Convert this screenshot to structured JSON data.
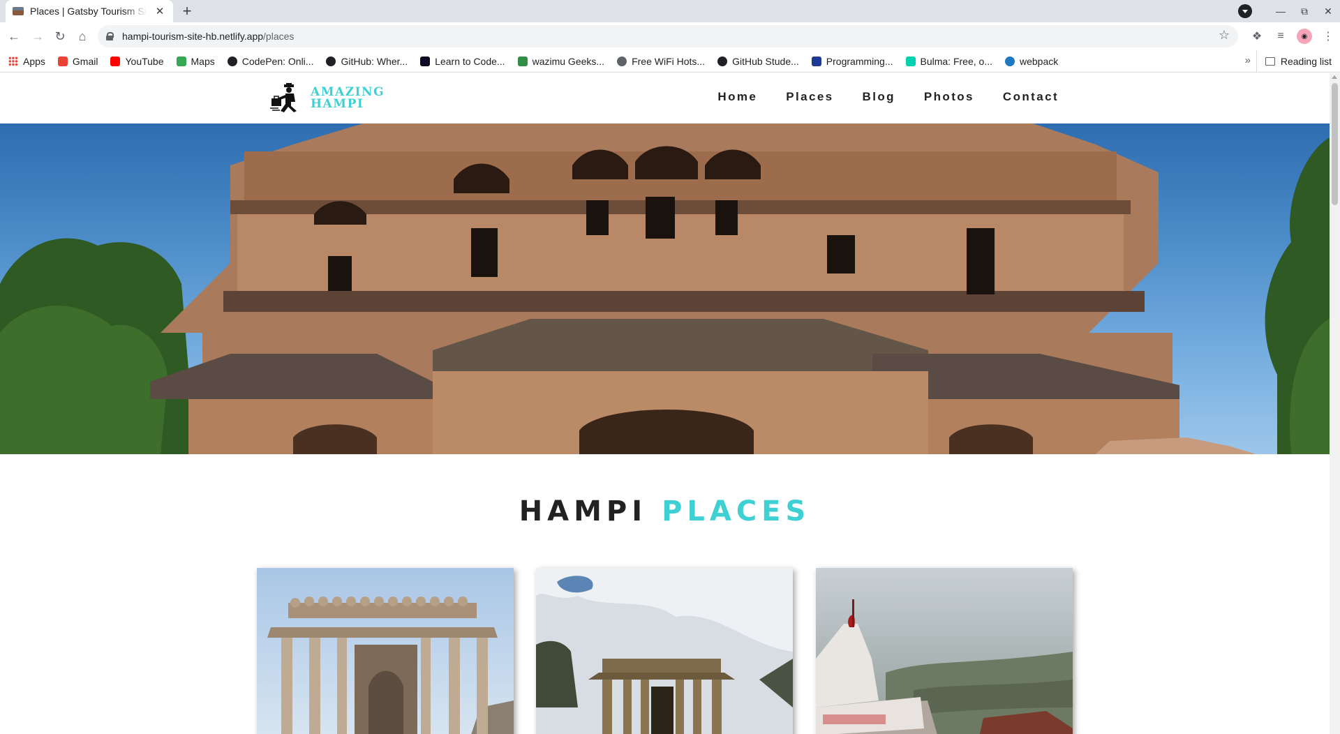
{
  "browser": {
    "tab_title": "Places | Gatsby Tourism Si",
    "tab_close": "✕",
    "new_tab": "+",
    "url_host": "hampi-tourism-site-hb.netlify.app",
    "url_path": "/places",
    "bookmarks": [
      {
        "label": "Apps",
        "icon": "apps-grid-icon",
        "color": "#ea4335"
      },
      {
        "label": "Gmail",
        "icon": "gmail-icon",
        "color": "#ea4335"
      },
      {
        "label": "YouTube",
        "icon": "youtube-icon",
        "color": "#ff0000"
      },
      {
        "label": "Maps",
        "icon": "maps-pin-icon",
        "color": "#34a853"
      },
      {
        "label": "CodePen: Onli...",
        "icon": "codepen-icon",
        "color": "#202124"
      },
      {
        "label": "GitHub: Wher...",
        "icon": "github-icon",
        "color": "#202124"
      },
      {
        "label": "Learn to Code...",
        "icon": "freecodecamp-icon",
        "color": "#0a0a23"
      },
      {
        "label": "wazimu Geeks...",
        "icon": "wazimu-icon",
        "color": "#2f8d46"
      },
      {
        "label": "Free WiFi Hots...",
        "icon": "globe-icon",
        "color": "#5f6368"
      },
      {
        "label": "GitHub Stude...",
        "icon": "github-icon",
        "color": "#202124"
      },
      {
        "label": "Programming...",
        "icon": "programming-icon",
        "color": "#1f3a93"
      },
      {
        "label": "Bulma: Free, o...",
        "icon": "bulma-icon",
        "color": "#00d1b2"
      },
      {
        "label": "webpack",
        "icon": "webpack-icon",
        "color": "#1c78c0"
      }
    ],
    "bookmarks_overflow": "»",
    "reading_list": "Reading list"
  },
  "site": {
    "logo_line1": "AMAZING",
    "logo_line2": "HAMPI",
    "menu": [
      "Home",
      "Places",
      "Blog",
      "Photos",
      "Contact"
    ],
    "section_title_dark": "HAMPI",
    "section_title_accent": "PLACES",
    "cards": [
      {
        "name": "pillared-mandapa",
        "icon": "place-photo"
      },
      {
        "name": "temple-colonnade",
        "icon": "place-photo"
      },
      {
        "name": "hilltop-hanuman-temple",
        "icon": "place-photo"
      }
    ]
  },
  "colors": {
    "accent": "#3fd0d4",
    "text_dark": "#222222"
  }
}
